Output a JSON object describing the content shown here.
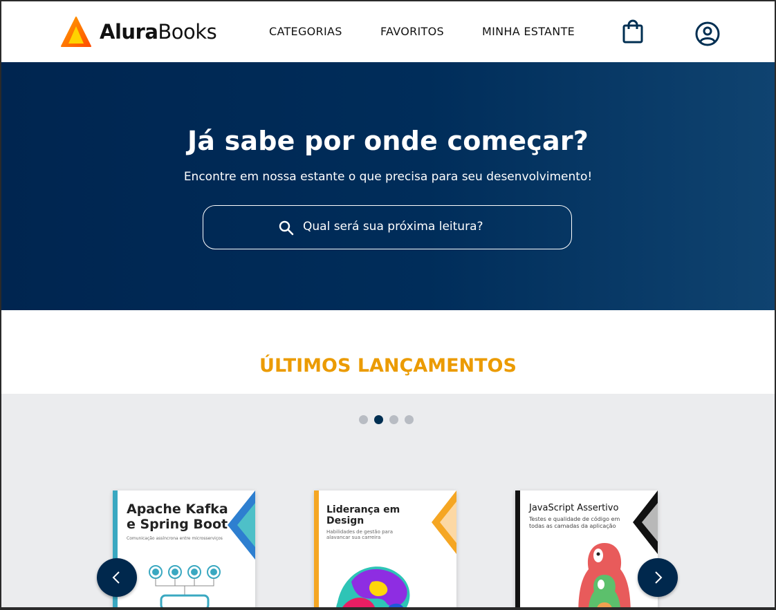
{
  "header": {
    "logo": {
      "brand_bold": "Alura",
      "brand_light": "Books"
    },
    "nav": [
      "CATEGORIAS",
      "FAVORITOS",
      "MINHA ESTANTE"
    ],
    "icons": [
      "shopping-bag-icon",
      "user-icon"
    ]
  },
  "hero": {
    "title": "Já sabe por onde começar?",
    "subtitle": "Encontre em nossa estante o que precisa para seu desenvolvimento!",
    "search_placeholder": "Qual será sua próxima leitura?"
  },
  "releases": {
    "title": "ÚLTIMOS LANÇAMENTOS",
    "carousel_dots": 4,
    "active_dot": 1,
    "books": [
      {
        "title": "Apache Kafka e Spring Boot",
        "subtitle": "Comunicação assíncrona entre microsserviços",
        "accent": "#3aa8c1"
      },
      {
        "title": "Liderança em Design",
        "subtitle": "Habilidades de gestão para alavancar sua carreira",
        "accent": "#f5a623"
      },
      {
        "title": "JavaScript Assertivo",
        "subtitle": "Testes e qualidade de código em todas as camadas da aplicação",
        "accent": "#111111"
      }
    ]
  },
  "colors": {
    "navy": "#002f52",
    "orange": "#eb9b00",
    "gray_bg": "#ebecee"
  }
}
